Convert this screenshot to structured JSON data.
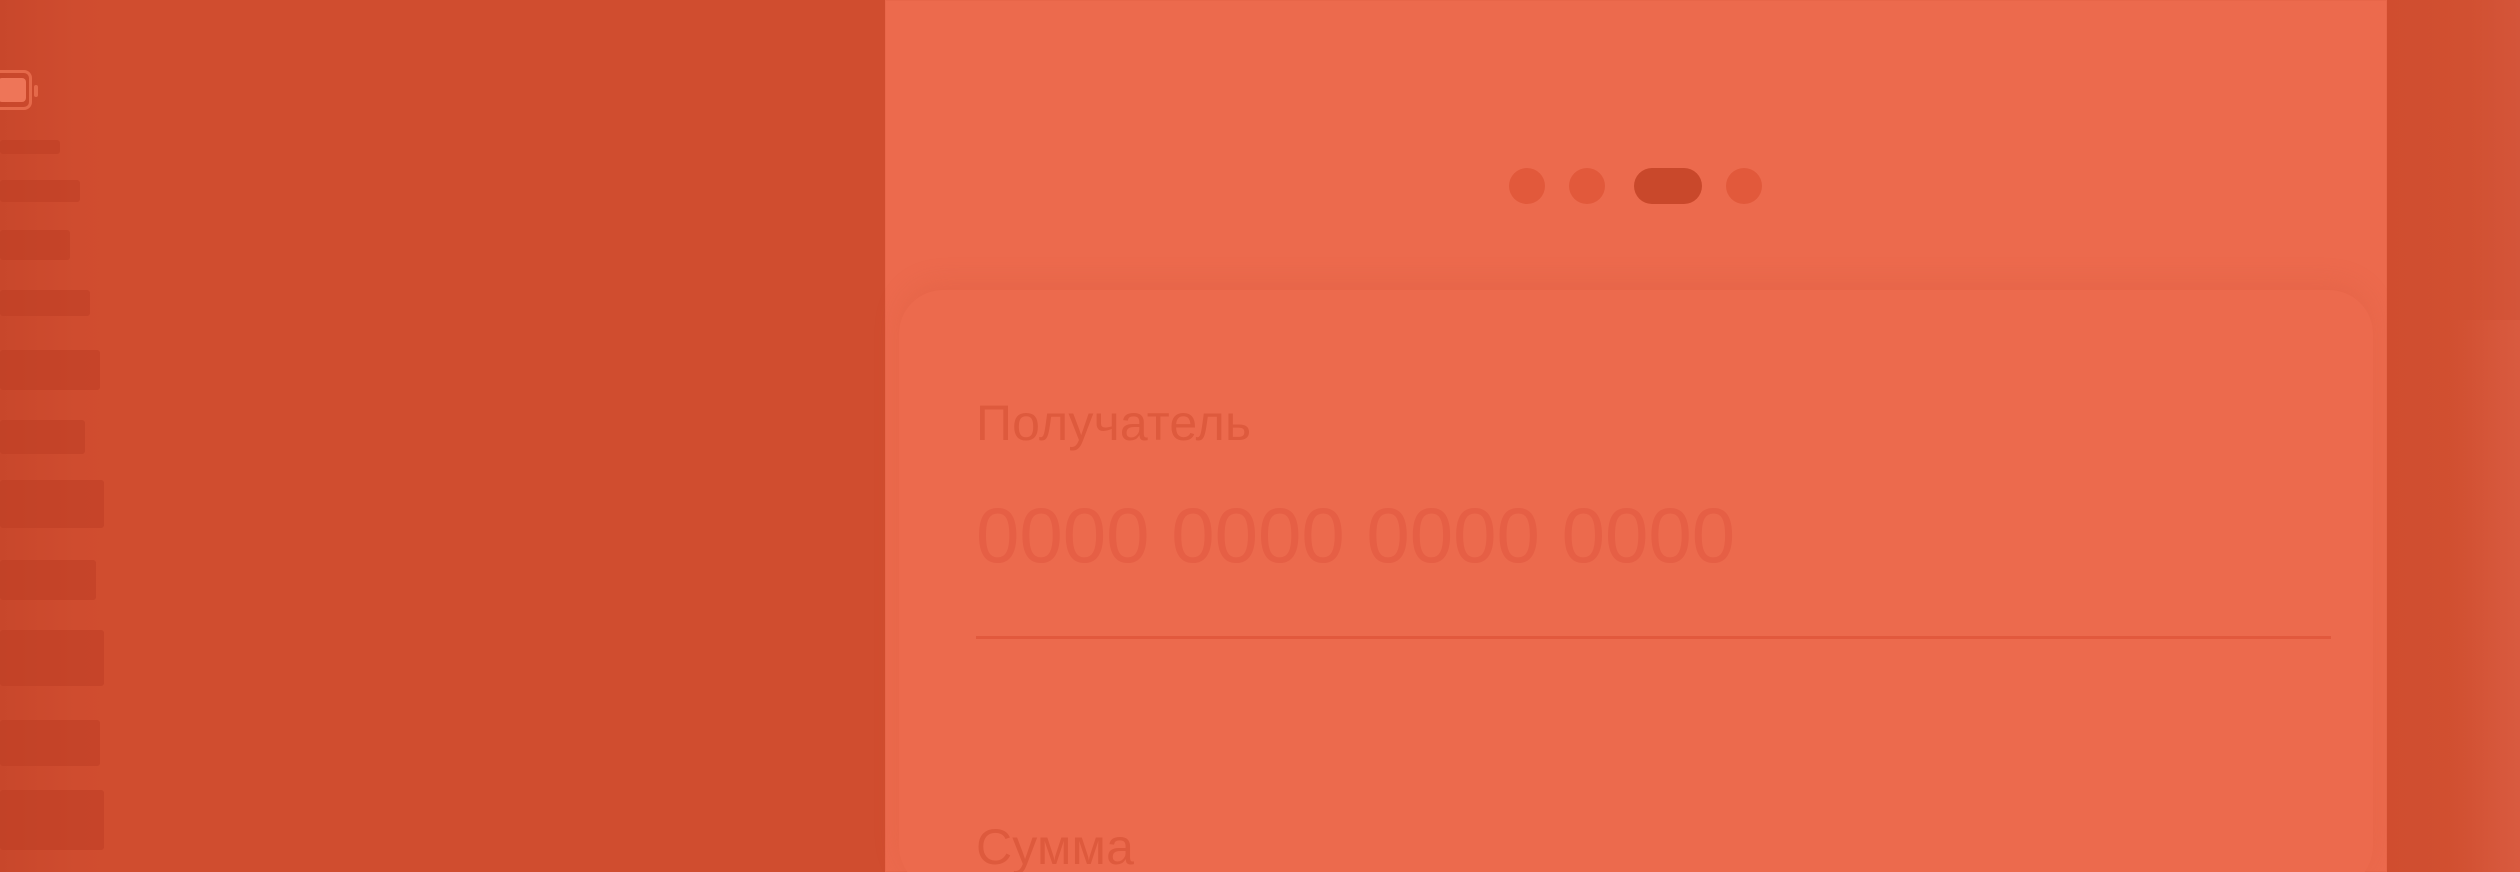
{
  "colors": {
    "background": "#D04D2F",
    "panel": "#EC6A4D",
    "active_dot": "#C9482B",
    "inactive_dot": "#E2593B",
    "label_text": "#DE5A3D"
  },
  "status_bar": {
    "battery_icon": "battery-icon"
  },
  "pager": {
    "total": 4,
    "active_index": 2
  },
  "form": {
    "recipient": {
      "label": "Получатель",
      "value": "",
      "placeholder": "0000 0000 0000 0000"
    },
    "amount": {
      "label": "Сумма"
    }
  }
}
